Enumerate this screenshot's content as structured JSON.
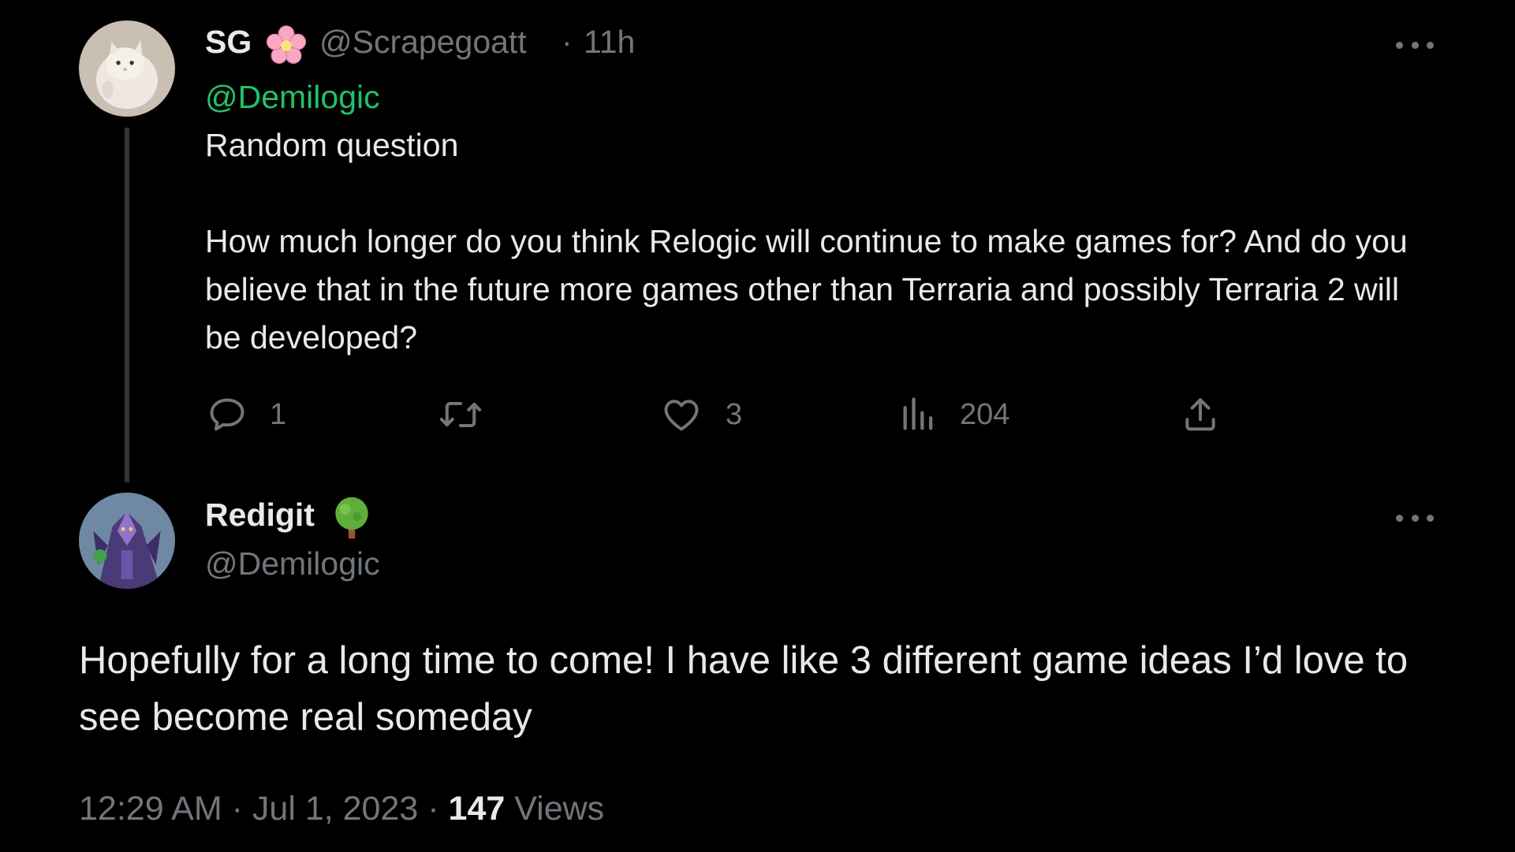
{
  "parent_tweet": {
    "display_name": "SG",
    "name_emoji": "cherry-blossom-icon",
    "handle": "@Scrapegoatt",
    "separator": "·",
    "time_ago": "11h",
    "mention": "@Demilogic",
    "line1": "Random question",
    "body": "How much longer do you think Relogic will continue to make games for? And do you believe that in the future more games other than Terraria and possibly Terraria 2 will be developed?",
    "actions": {
      "reply_count": "1",
      "retweet_count": "",
      "like_count": "3",
      "views_count": "204"
    }
  },
  "reply_tweet": {
    "display_name": "Redigit",
    "name_emoji": "tree-icon",
    "handle": "@Demilogic",
    "text": "Hopefully for a long time to come! I have like 3 different game ideas I’d love to see become real someday",
    "time": "12:29 AM",
    "sep1": "·",
    "date": "Jul 1, 2023",
    "sep2": "·",
    "views_count": "147",
    "views_label": "Views"
  },
  "colors": {
    "background": "#000000",
    "text": "#e7e9ea",
    "muted": "#71767b",
    "mention": "#1fc26a",
    "thread_line": "#333639"
  }
}
